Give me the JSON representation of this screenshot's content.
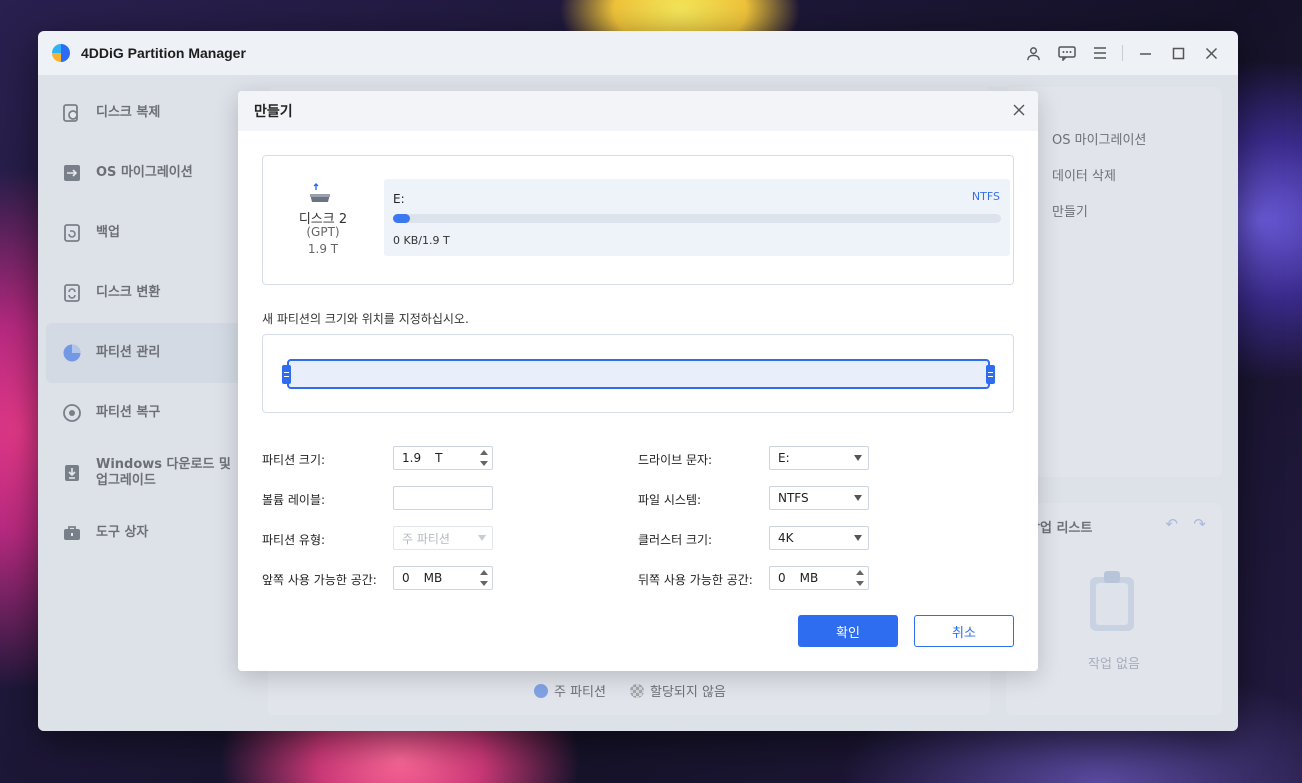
{
  "app": {
    "title": "4DDiG Partition Manager"
  },
  "sidebar": {
    "items": [
      {
        "label": "디스크 복제",
        "icon": "disk-clone-icon"
      },
      {
        "label": "OS 마이그레이션",
        "icon": "os-migration-icon"
      },
      {
        "label": "백업",
        "icon": "backup-icon"
      },
      {
        "label": "디스크 변환",
        "icon": "disk-convert-icon"
      },
      {
        "label": "파티션 관리",
        "icon": "partition-pie-icon",
        "active": true
      },
      {
        "label": "파티션 복구",
        "icon": "partition-recover-icon"
      },
      {
        "label": "Windows 다운로드 및 업그레이드",
        "icon": "windows-download-icon"
      },
      {
        "label": "도구 상자",
        "icon": "toolbox-icon"
      }
    ]
  },
  "right_panel": {
    "items": [
      "OS 마이그레이션",
      "데이터 삭제",
      "만들기"
    ]
  },
  "task_panel": {
    "title": "작업 리스트",
    "empty": "작업 없음"
  },
  "legend": {
    "primary": "주 파티션",
    "unallocated": "할당되지 않음"
  },
  "dialog": {
    "title": "만들기",
    "disk": {
      "name": "디스크 2",
      "type": "(GPT)",
      "size": "1.9 T"
    },
    "partition": {
      "letter": "E:",
      "fs": "NTFS",
      "usage": "0 KB/1.9 T",
      "used_fraction": 0.0
    },
    "instruction": "새 파티션의 크기와 위치를 지정하십시오.",
    "fields": {
      "size_label": "파티션 크기:",
      "size_value": "1.9",
      "size_unit": "T",
      "volume_label": "볼륨 레이블:",
      "volume_value": "",
      "type_label": "파티션 유형:",
      "type_value": "주 파티션",
      "front_label": "앞쪽 사용 가능한 공간:",
      "front_value": "0",
      "front_unit": "MB",
      "drive_label": "드라이브 문자:",
      "drive_value": "E:",
      "fs_label": "파일 시스템:",
      "fs_value": "NTFS",
      "cluster_label": "클러스터 크기:",
      "cluster_value": "4K",
      "back_label": "뒤쪽 사용 가능한 공간:",
      "back_value": "0",
      "back_unit": "MB"
    },
    "ok": "확인",
    "cancel": "취소"
  },
  "colors": {
    "accent": "#2e6cf0",
    "sidebar_active": "#dde3ee"
  }
}
